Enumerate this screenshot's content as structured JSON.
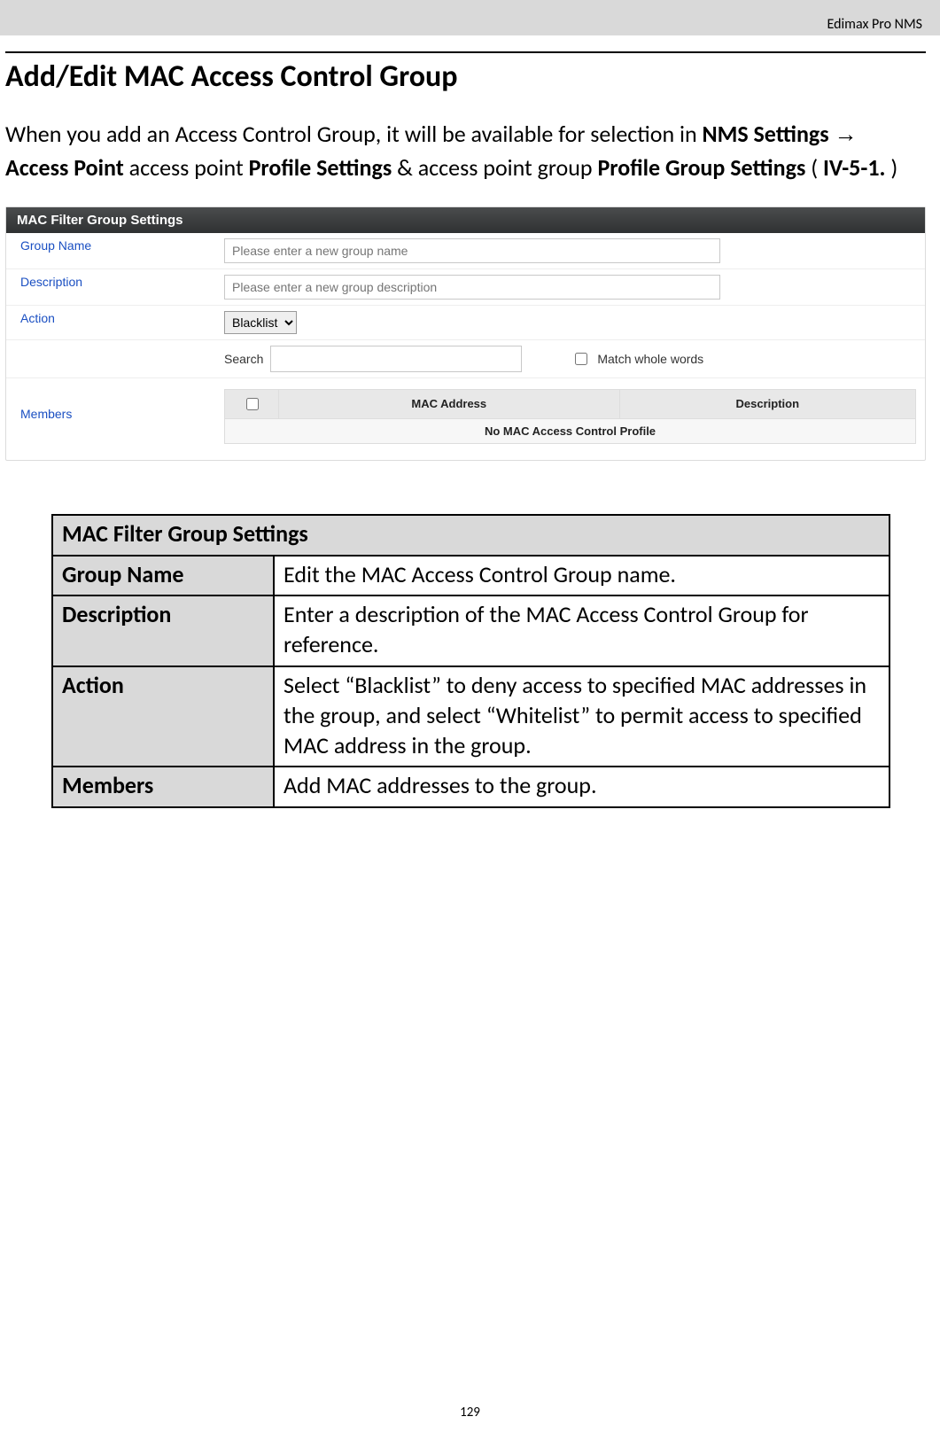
{
  "header": {
    "product": "Edimax Pro NMS"
  },
  "title": "Add/Edit MAC Access Control Group",
  "intro": {
    "pre": "When you add an Access Control Group, it will be available for selection in ",
    "b1": "NMS Settings",
    "arrow": " → ",
    "b2": "Access Point",
    "mid1": " access point ",
    "b3": "Profile Settings",
    "amp": " & access point group ",
    "b4": "Profile Group Settings",
    "paren_open": " (",
    "b5": "IV-5-1.",
    "paren_close": ")"
  },
  "panel": {
    "title": "MAC Filter Group Settings",
    "labels": {
      "group_name": "Group Name",
      "description": "Description",
      "action": "Action",
      "members": "Members"
    },
    "placeholders": {
      "group_name": "Please enter a new group name",
      "description": "Please enter a new group description"
    },
    "action_value": "Blacklist",
    "search_label": "Search",
    "match_label": "Match whole words",
    "members_headers": {
      "mac": "MAC Address",
      "desc": "Description"
    },
    "members_empty": "No MAC Access Control Profile"
  },
  "desc_table": {
    "caption": "MAC Filter Group Settings",
    "rows": [
      {
        "k": "Group Name",
        "v": "Edit the MAC Access Control Group name."
      },
      {
        "k": "Description",
        "v": "Enter a description of the MAC Access Control Group for reference."
      },
      {
        "k": "Action",
        "v": "Select “Blacklist” to deny access to specified MAC addresses in the group, and select “Whitelist” to permit access to specified MAC address in the group."
      },
      {
        "k": "Members",
        "v": "Add MAC addresses to the group."
      }
    ]
  },
  "page_number": "129"
}
